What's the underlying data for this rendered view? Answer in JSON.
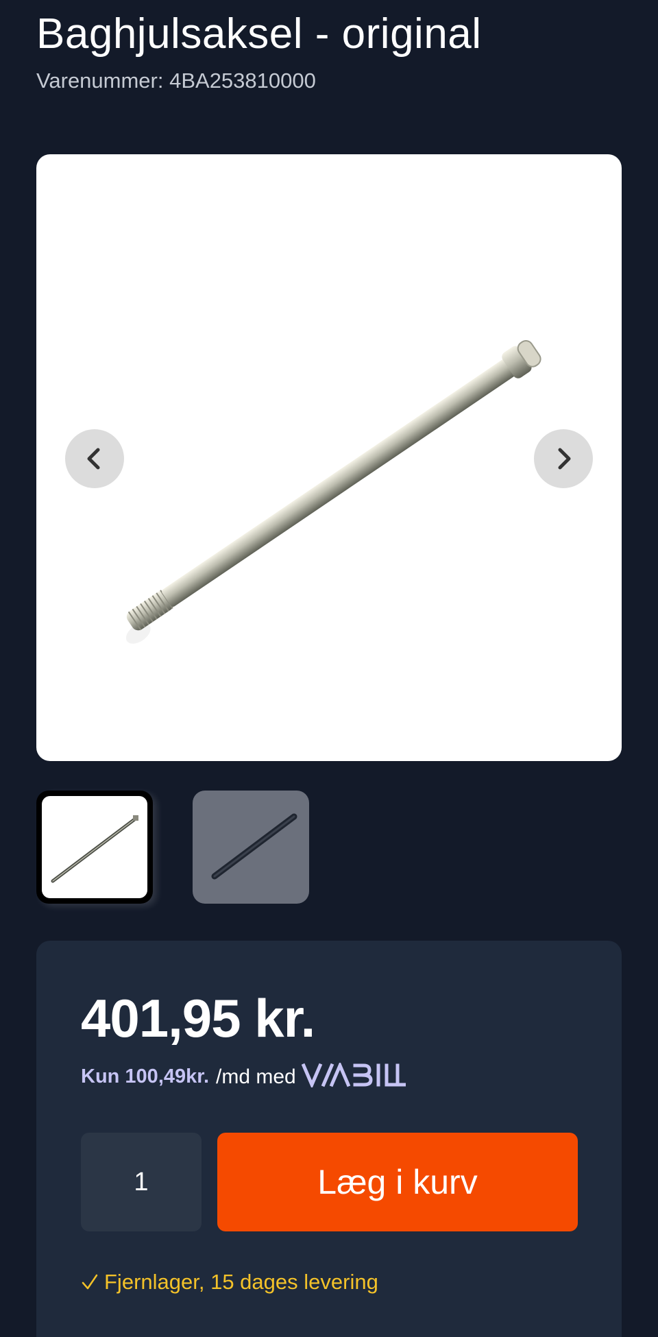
{
  "product": {
    "title": "Baghjulsaksel - original",
    "sku_label": "Varenummer: 4BA253810000"
  },
  "gallery": {
    "image_alt": "Baghjulsaksel",
    "prev_icon": "chevron-left-icon",
    "next_icon": "chevron-right-icon",
    "thumbnails": [
      {
        "name": "thumbnail-1",
        "selected": true
      },
      {
        "name": "thumbnail-2",
        "selected": false
      }
    ]
  },
  "purchase": {
    "price": "401,95 kr.",
    "installment_amount": "Kun 100,49kr.",
    "installment_text": "/md med",
    "provider_logo": "ViaBill",
    "quantity": "1",
    "add_to_cart_label": "Læg i kurv",
    "stock_icon": "checkmark-icon",
    "stock_text": "Fjernlager, 15 dages levering"
  },
  "colors": {
    "background": "#131a29",
    "panel": "#1f2a3c",
    "accent": "#f54a00",
    "stock": "#f4c229",
    "viabill": "#c6c4f4"
  }
}
